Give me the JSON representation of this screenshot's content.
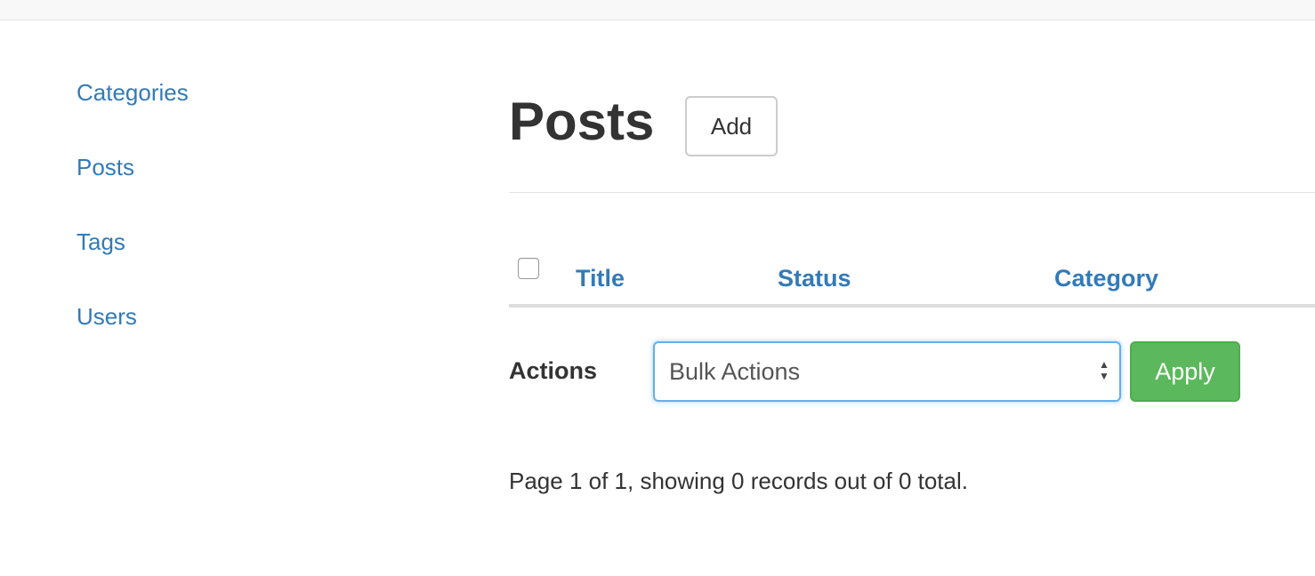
{
  "sidebar": {
    "items": [
      {
        "label": "Categories"
      },
      {
        "label": "Posts"
      },
      {
        "label": "Tags"
      },
      {
        "label": "Users"
      }
    ]
  },
  "header": {
    "title": "Posts",
    "add_label": "Add"
  },
  "table": {
    "columns": [
      "Title",
      "Status",
      "Category"
    ],
    "rows": []
  },
  "actions": {
    "label": "Actions",
    "select_value": "Bulk Actions",
    "apply_label": "Apply"
  },
  "pagination": {
    "text": "Page 1 of 1, showing 0 records out of 0 total."
  },
  "colors": {
    "link": "#337ab7",
    "apply": "#5cb85c",
    "focus": "#66afe9"
  },
  "icons": {
    "select_arrows": "chevron-up-down-icon"
  }
}
